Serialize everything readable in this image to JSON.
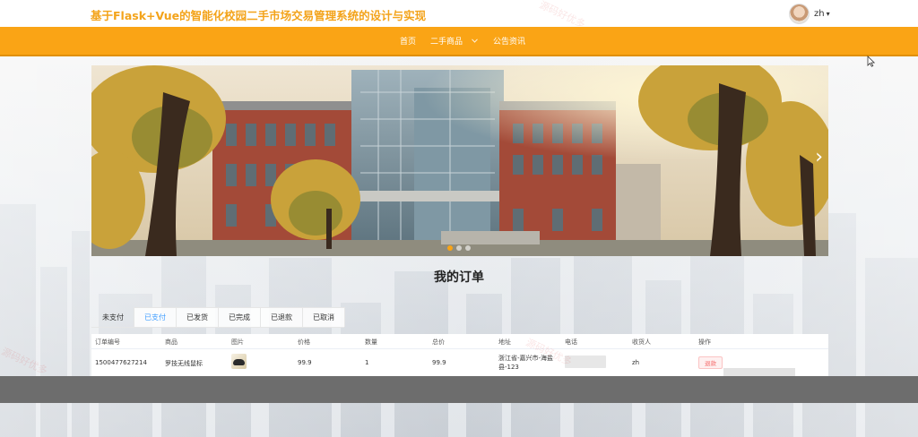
{
  "header": {
    "title": "基于Flask+Vue的智能化校园二手市场交易管理系统的设计与实现",
    "username": "zh",
    "caret": "▾"
  },
  "nav": {
    "items": [
      "首页",
      "二手商品",
      "公告资讯"
    ],
    "dropdown_icon": "chevron-down-icon"
  },
  "banner": {
    "next_symbol": "›",
    "slide_count": 3,
    "active_slide": 1
  },
  "orders": {
    "heading": "我的订单",
    "tabs": [
      "未支付",
      "已支付",
      "已发货",
      "已完成",
      "已退款",
      "已取消"
    ],
    "active_tab": "已支付",
    "columns": [
      "订单编号",
      "商品",
      "图片",
      "价格",
      "数量",
      "总价",
      "地址",
      "电话",
      "收货人",
      "操作"
    ],
    "rows": [
      {
        "order_no": "1500477627214",
        "product": "罗技无线鼠标",
        "price": "99.9",
        "quantity": "1",
        "total": "99.9",
        "address": "浙江省-嘉兴市-海盐县-123",
        "receiver": "zh",
        "action": "退款"
      }
    ]
  },
  "watermark": "源码好优多",
  "colors": {
    "accent": "#faa415",
    "title": "#f3a31a",
    "active_tab": "#409eff",
    "footer": "#6d6d6d",
    "refund": "#f56c6c"
  }
}
